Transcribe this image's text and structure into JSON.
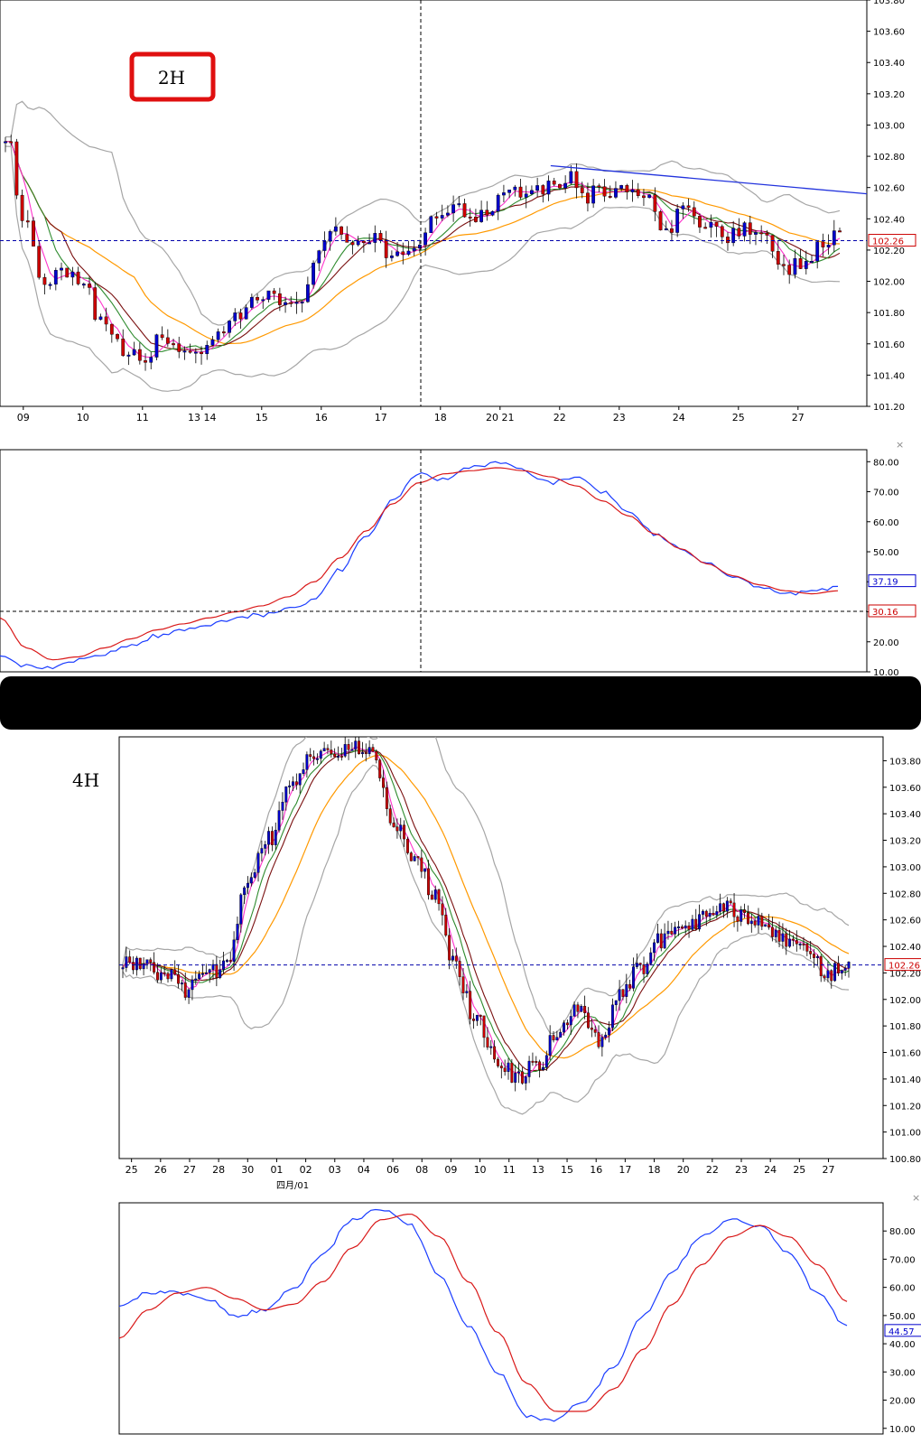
{
  "chart_data": [
    {
      "type": "candlestick",
      "label": "2H",
      "y_ticks": [
        "103.80",
        "103.60",
        "103.40",
        "103.20",
        "103.00",
        "102.80",
        "102.60",
        "102.40",
        "102.20",
        "102.00",
        "101.80",
        "101.60",
        "101.40",
        "101.20"
      ],
      "ylim": [
        101.2,
        103.8
      ],
      "x_dates": [
        "09",
        "10",
        "11",
        "13 14",
        "15",
        "16",
        "17",
        "18",
        "20 21",
        "22",
        "23",
        "24",
        "25",
        "27"
      ],
      "current_price": "102.26",
      "trendline": {
        "from": 102.74,
        "to": 102.56
      },
      "candles_seed": [
        102.95,
        102.35,
        101.95,
        102.05,
        101.95,
        101.75,
        101.55,
        101.5,
        101.62,
        101.58,
        101.55,
        101.62,
        101.75,
        101.9,
        101.88,
        101.85,
        102.15,
        102.3,
        102.28,
        102.25,
        102.12,
        102.22,
        102.4,
        102.48,
        102.42,
        102.48,
        102.62,
        102.58,
        102.62,
        102.66,
        102.55,
        102.58,
        102.6,
        102.52,
        102.3,
        102.45,
        102.4,
        102.3,
        102.35,
        102.28,
        102.05,
        102.12,
        102.2,
        102.35
      ]
    },
    {
      "type": "line",
      "label": "oscillator-2H",
      "y_ticks": [
        "80.00",
        "70.00",
        "60.00",
        "50.00",
        "40.00",
        "30.00",
        "20.00",
        "10.00"
      ],
      "ylim": [
        10,
        84
      ],
      "reference_level": "30.16",
      "current_value": "37.19",
      "series": [
        {
          "name": "blue",
          "color": "#1a3cff",
          "values": [
            16,
            12,
            11,
            14,
            16,
            19,
            22,
            24,
            26,
            28,
            29,
            31,
            34,
            44,
            55,
            67,
            76,
            74,
            78,
            80,
            77,
            73,
            75,
            70,
            64,
            56,
            51,
            46,
            42,
            38,
            36,
            37,
            38
          ]
        },
        {
          "name": "red",
          "color": "#d91818",
          "values": [
            28,
            18,
            14,
            15,
            18,
            21,
            24,
            26,
            28,
            30,
            32,
            35,
            40,
            48,
            57,
            66,
            73,
            76,
            77,
            78,
            77,
            75,
            72,
            67,
            62,
            56,
            51,
            46,
            42,
            39,
            37,
            36,
            37
          ]
        }
      ]
    },
    {
      "type": "candlestick",
      "label": "4H",
      "y_ticks": [
        "103.80",
        "103.60",
        "103.40",
        "103.20",
        "103.00",
        "102.80",
        "102.60",
        "102.40",
        "102.20",
        "102.00",
        "101.80",
        "101.60",
        "101.40",
        "101.20",
        "101.00",
        "100.80"
      ],
      "ylim": [
        100.8,
        103.98
      ],
      "x_dates": [
        "25",
        "26",
        "27",
        "28",
        "30",
        "01",
        "02",
        "03",
        "04",
        "06",
        "08",
        "09",
        "10",
        "11",
        "13",
        "15",
        "16",
        "17",
        "18",
        "20",
        "22",
        "23",
        "24",
        "25",
        "27"
      ],
      "month_label": "四月/01",
      "current_price": "102.26",
      "candles_seed": [
        102.3,
        102.25,
        102.2,
        102.05,
        102.18,
        102.25,
        102.85,
        103.2,
        103.55,
        103.8,
        103.88,
        103.92,
        103.85,
        103.35,
        103.1,
        102.8,
        102.25,
        101.85,
        101.55,
        101.4,
        101.52,
        101.75,
        101.95,
        101.7,
        102.05,
        102.25,
        102.45,
        102.5,
        102.6,
        102.68,
        102.62,
        102.55,
        102.45,
        102.35,
        102.2,
        102.28
      ]
    },
    {
      "type": "line",
      "label": "oscillator-4H",
      "y_ticks": [
        "80.00",
        "70.00",
        "60.00",
        "50.00",
        "40.00",
        "30.00",
        "20.00",
        "10.00"
      ],
      "ylim": [
        8,
        90
      ],
      "current_value": "44.57",
      "series": [
        {
          "name": "blue",
          "color": "#1a3cff",
          "values": [
            54,
            58,
            58,
            56,
            50,
            52,
            60,
            72,
            84,
            88,
            82,
            64,
            46,
            30,
            14,
            13,
            20,
            32,
            50,
            66,
            78,
            84,
            82,
            72,
            58,
            46
          ]
        },
        {
          "name": "red",
          "color": "#d91818",
          "values": [
            42,
            52,
            58,
            60,
            56,
            52,
            54,
            62,
            74,
            84,
            86,
            78,
            62,
            44,
            26,
            16,
            16,
            24,
            38,
            54,
            68,
            78,
            82,
            78,
            68,
            55
          ]
        }
      ]
    }
  ]
}
